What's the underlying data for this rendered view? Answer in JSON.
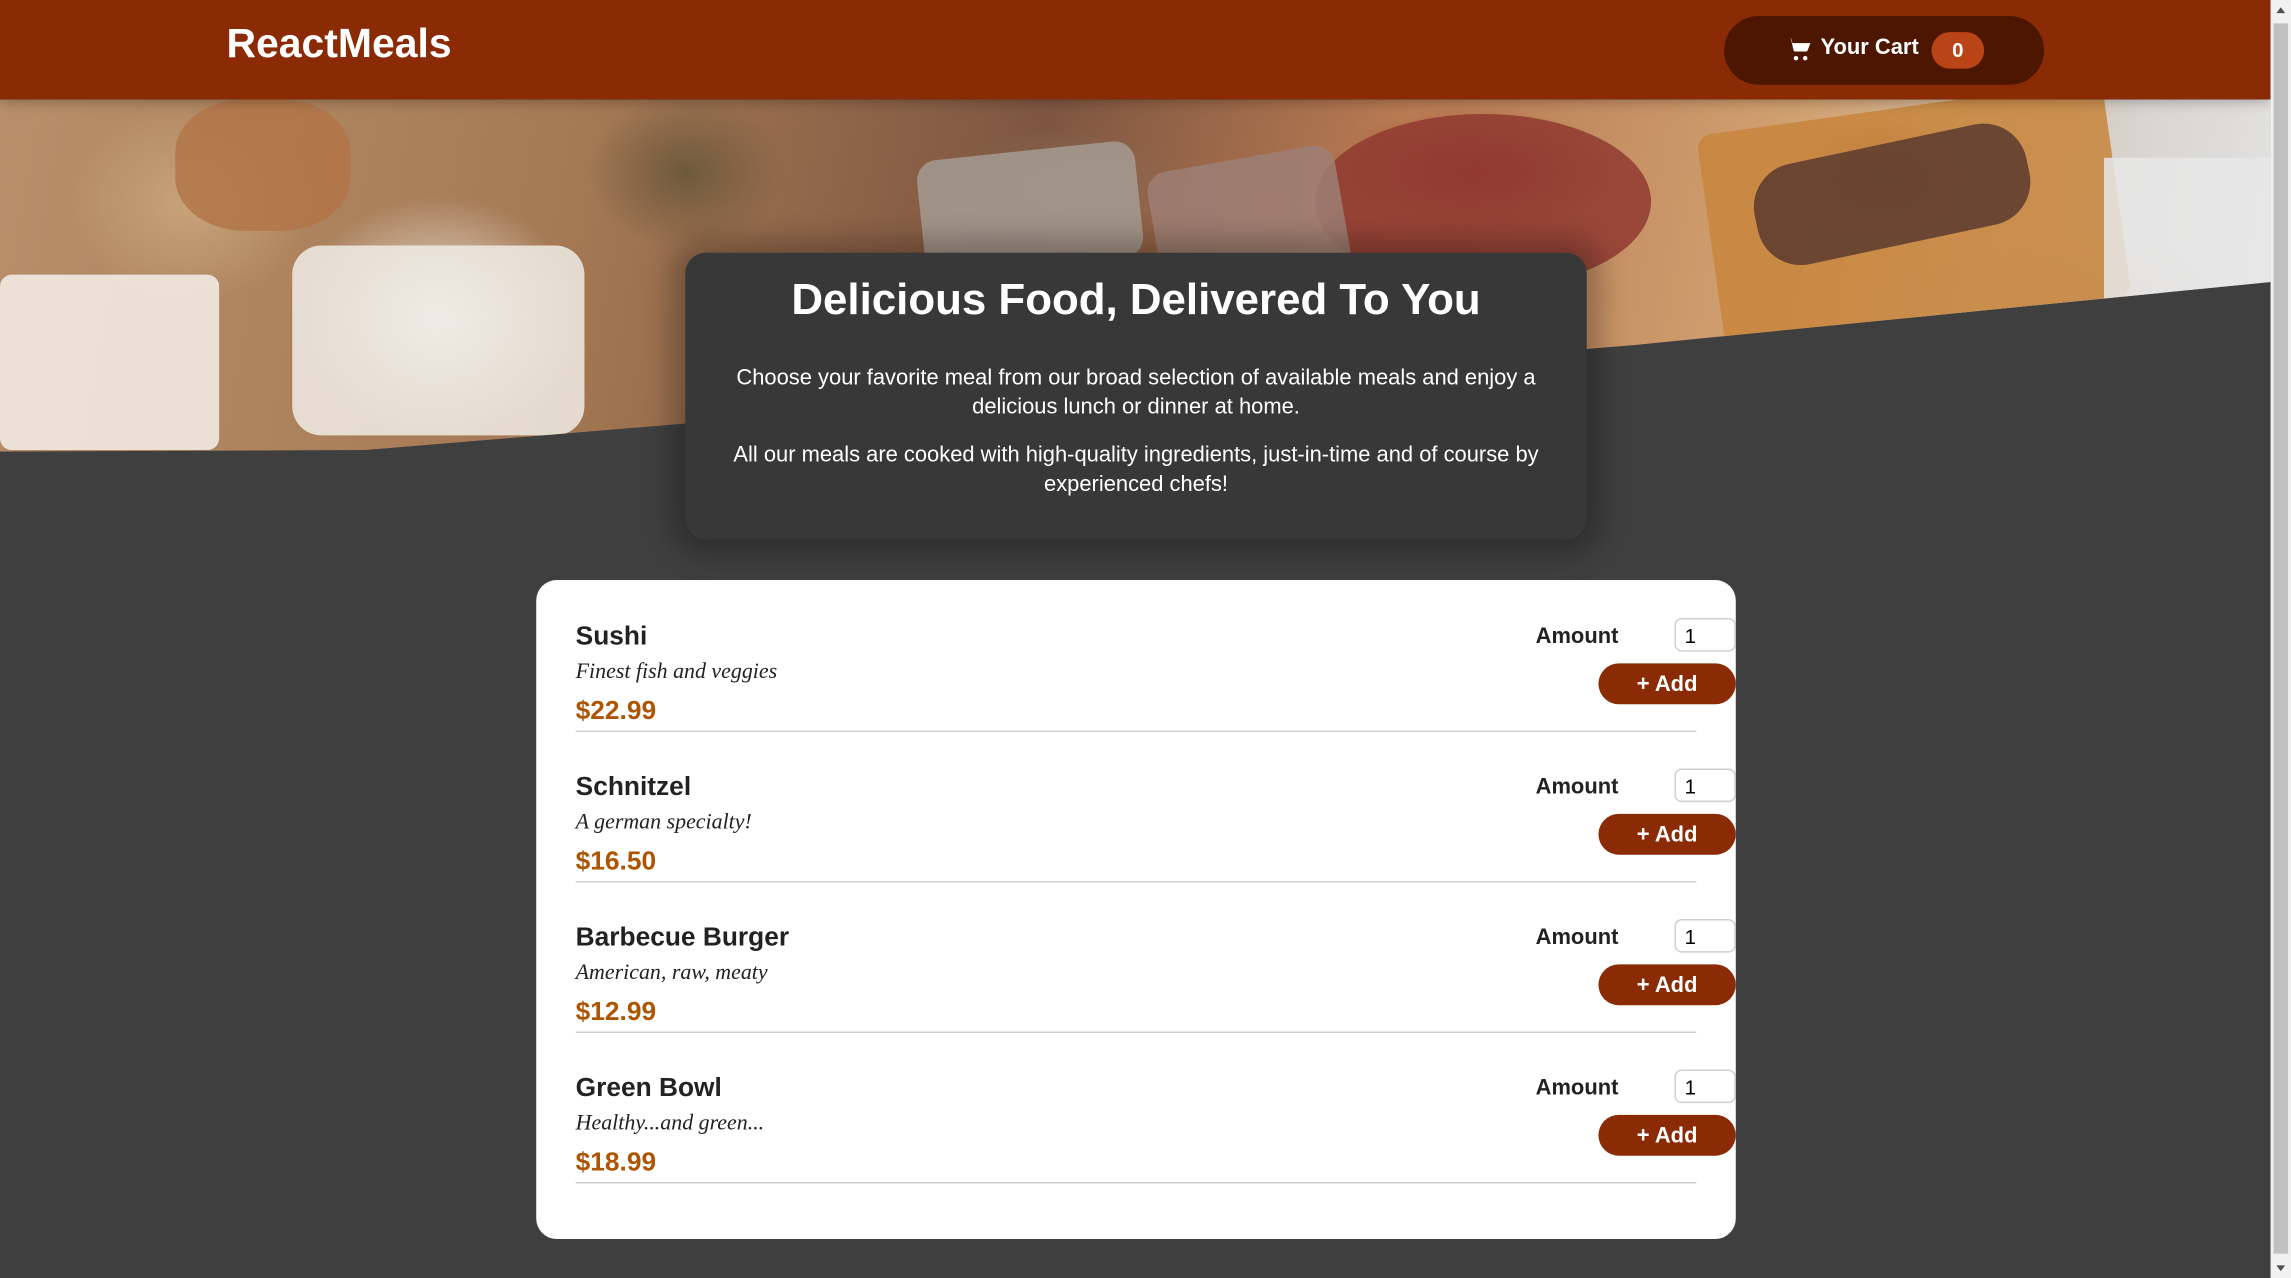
{
  "header": {
    "brand": "ReactMeals",
    "cart": {
      "label": "Your Cart",
      "count": "0",
      "icon": "cart-icon"
    }
  },
  "summary": {
    "title": "Delicious Food, Delivered To You",
    "paragraph1": "Choose your favorite meal from our broad selection of available meals and enjoy a delicious lunch or dinner at home.",
    "paragraph2": "All our meals are cooked with high-quality ingredients, just-in-time and of course by experienced chefs!"
  },
  "meals": [
    {
      "name": "Sushi",
      "description": "Finest fish and veggies",
      "price": "$22.99",
      "amount_label": "Amount",
      "amount": "1",
      "add_label": "+ Add"
    },
    {
      "name": "Schnitzel",
      "description": "A german specialty!",
      "price": "$16.50",
      "amount_label": "Amount",
      "amount": "1",
      "add_label": "+ Add"
    },
    {
      "name": "Barbecue Burger",
      "description": "American, raw, meaty",
      "price": "$12.99",
      "amount_label": "Amount",
      "amount": "1",
      "add_label": "+ Add"
    },
    {
      "name": "Green Bowl",
      "description": "Healthy...and green...",
      "price": "$18.99",
      "amount_label": "Amount",
      "amount": "1",
      "add_label": "+ Add"
    }
  ],
  "colors": {
    "header": "#8a2b06",
    "cart_button": "#4d1601",
    "badge": "#b94517",
    "price": "#ad5502",
    "background": "#3f3f3f"
  }
}
